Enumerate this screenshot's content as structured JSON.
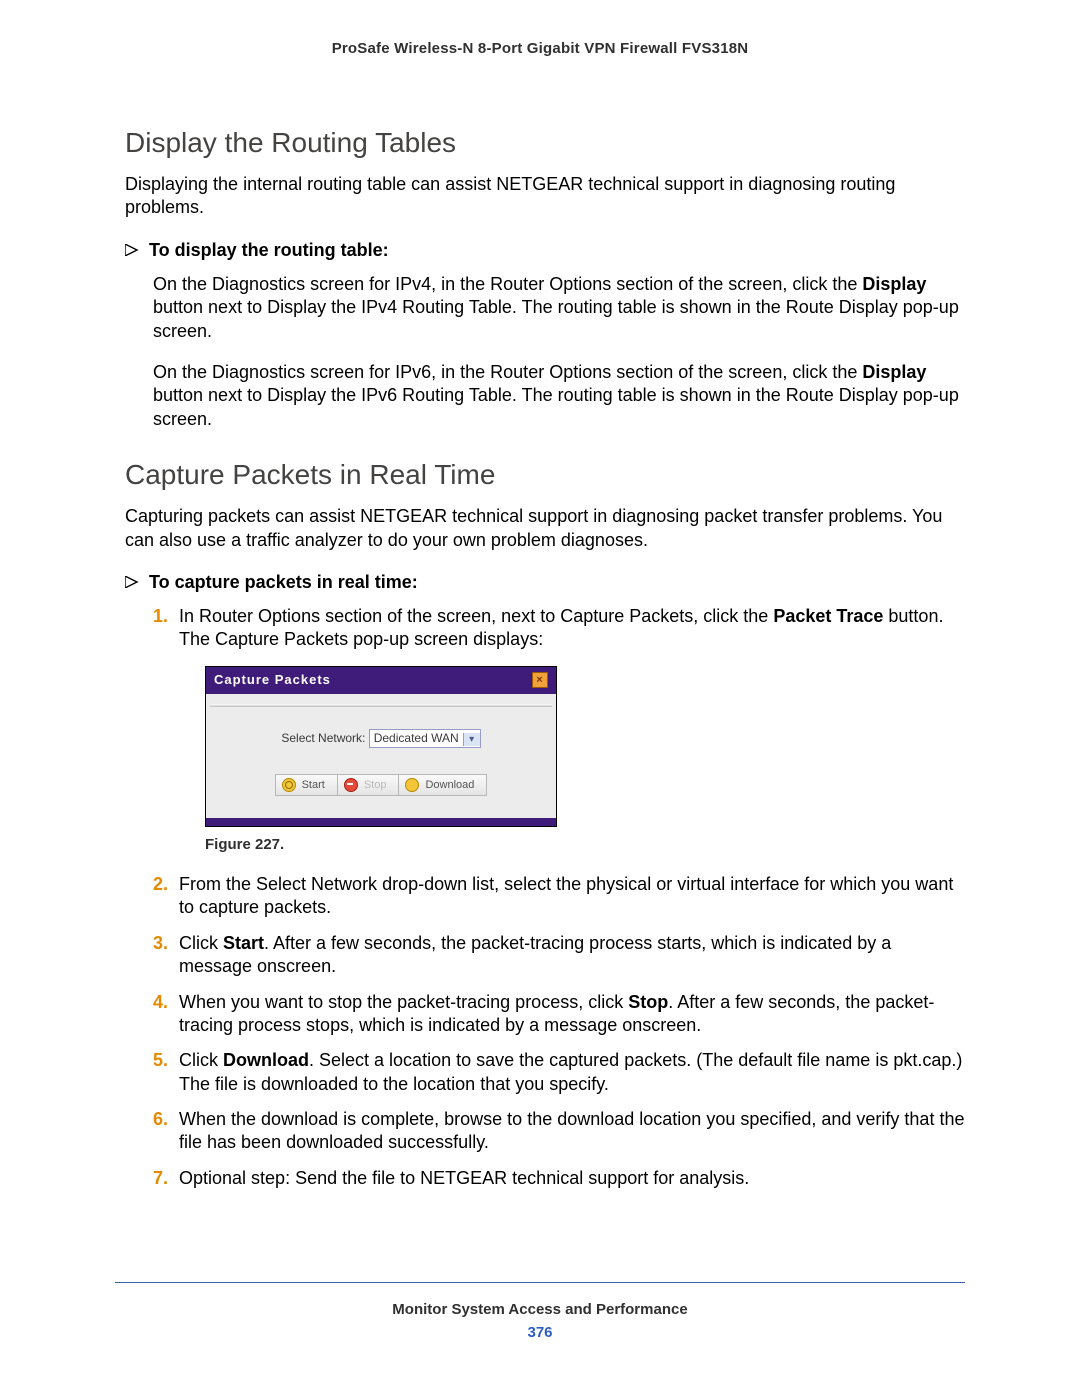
{
  "header": "ProSafe Wireless-N 8-Port Gigabit VPN Firewall FVS318N",
  "sec1": {
    "title": "Display the Routing Tables",
    "intro": "Displaying the internal routing table can assist NETGEAR technical support in diagnosing routing problems.",
    "proc_title": "To display the routing table:",
    "p1a": "On the Diagnostics screen for IPv4, in the Router Options section of the screen, click the ",
    "p1b": "Display",
    "p1c": " button next to Display the IPv4 Routing Table. The routing table is shown in the Route Display pop-up screen.",
    "p2a": "On the Diagnostics screen for IPv6, in the Router Options section of the screen, click the ",
    "p2b": "Display",
    "p2c": " button next to Display the IPv6 Routing Table. The routing table is shown in the Route Display pop-up screen."
  },
  "sec2": {
    "title": "Capture Packets in Real Time",
    "intro": "Capturing packets can assist NETGEAR technical support in diagnosing packet transfer problems. You can also use a traffic analyzer to do your own problem diagnoses.",
    "proc_title": "To capture packets in real time:",
    "steps": {
      "s1a": "In Router Options section of the screen, next to Capture Packets, click the ",
      "s1b": "Packet Trace",
      "s1c": " button. The Capture Packets pop-up screen displays:",
      "s2": "From the Select Network drop-down list, select the physical or virtual interface for which you want to capture packets.",
      "s3a": "Click ",
      "s3b": "Start",
      "s3c": ". After a few seconds, the packet-tracing process starts, which is indicated by a message onscreen.",
      "s4a": "When you want to stop the packet-tracing process, click ",
      "s4b": "Stop",
      "s4c": ". After a few seconds, the packet-tracing process stops, which is indicated by a message onscreen.",
      "s5a": "Click ",
      "s5b": "Download",
      "s5c": ". Select a location to save the captured packets. (The default file name is pkt.cap.) The file is downloaded to the location that you specify.",
      "s6": "When the download is complete, browse to the download location you specified, and verify that the file has been downloaded successfully.",
      "s7": "Optional step: Send the file to NETGEAR technical support for analysis."
    },
    "nums": {
      "n1": "1.",
      "n2": "2.",
      "n3": "3.",
      "n4": "4.",
      "n5": "5.",
      "n6": "6.",
      "n7": "7."
    }
  },
  "popup": {
    "title": "Capture Packets",
    "select_label": "Select Network:",
    "select_value": "Dedicated WAN",
    "btn_start": "Start",
    "btn_stop": "Stop",
    "btn_download": "Download"
  },
  "fig_caption": "Figure 227.",
  "footer": {
    "chapter": "Monitor System Access and Performance",
    "page": "376"
  }
}
